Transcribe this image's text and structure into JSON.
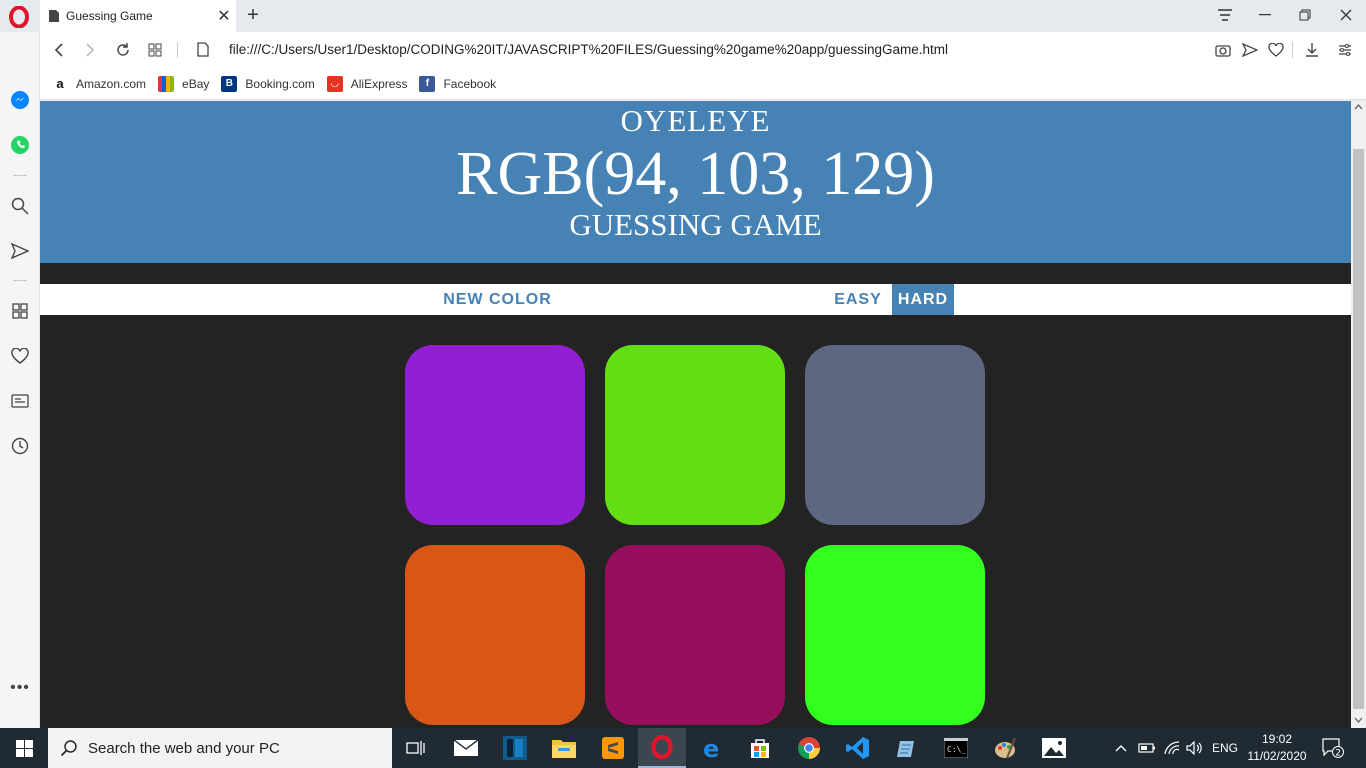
{
  "browser": {
    "tab_title": "Guessing Game",
    "url": "file:///C:/Users/User1/Desktop/CODING%20IT/JAVASCRIPT%20FILES/Guessing%20game%20app/guessingGame.html",
    "bookmarks": [
      {
        "label": "Amazon.com",
        "icon": "amazon-icon"
      },
      {
        "label": "eBay",
        "icon": "ebay-icon"
      },
      {
        "label": "Booking.com",
        "icon": "booking-icon"
      },
      {
        "label": "AliExpress",
        "icon": "aliexpress-icon"
      },
      {
        "label": "Facebook",
        "icon": "facebook-icon"
      }
    ]
  },
  "game": {
    "name": "OYELEYE",
    "rgb_display": "RGB(94, 103, 129)",
    "subtitle": "GUESSING GAME",
    "new_color_label": "NEW COLOR",
    "easy_label": "EASY",
    "hard_label": "HARD",
    "selected_mode": "HARD",
    "header_color": "#4682b4",
    "background_color": "#232323",
    "squares": [
      "#931fd4",
      "#62de14",
      "#5e6781",
      "#d95716",
      "#960f5c",
      "#32ff1e"
    ]
  },
  "taskbar": {
    "search_placeholder": "Search the web and your PC",
    "language": "ENG",
    "time": "19:02",
    "date": "11/02/2020",
    "notifications": "2"
  }
}
